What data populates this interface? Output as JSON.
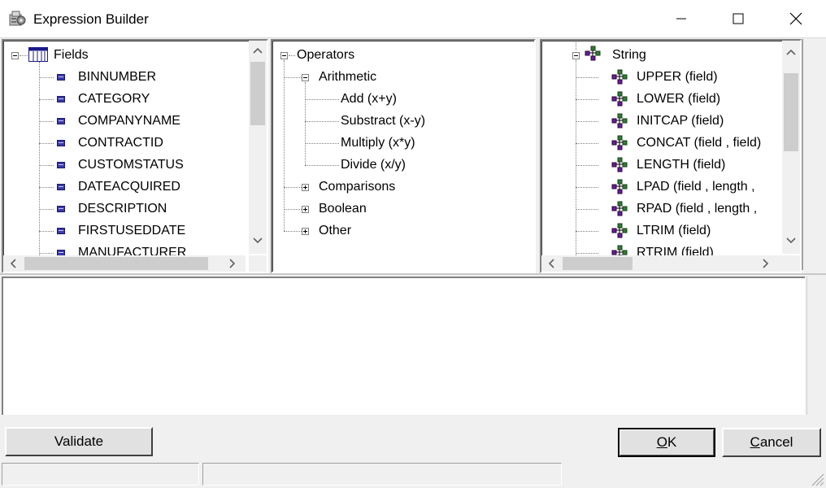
{
  "window": {
    "title": "Expression Builder",
    "icon": "app-icon",
    "controls": [
      "minimize-icon",
      "maximize-icon",
      "close-icon"
    ]
  },
  "fields_tree": {
    "root_label": "Fields",
    "items": [
      "BINNUMBER",
      "CATEGORY",
      "COMPANYNAME",
      "CONTRACTID",
      "CUSTOMSTATUS",
      "DATEACQUIRED",
      "DESCRIPTION",
      "FIRSTUSEDDATE",
      "MANUFACTURER"
    ]
  },
  "operators_tree": {
    "root_label": "Operators",
    "arithmetic": {
      "label": "Arithmetic",
      "items": [
        "Add (x+y)",
        "Substract (x-y)",
        "Multiply (x*y)",
        "Divide (x/y)"
      ]
    },
    "collapsed_groups": [
      "Comparisons",
      "Boolean",
      "Other"
    ]
  },
  "functions_tree": {
    "root_label": "String",
    "items": [
      "UPPER (field)",
      "LOWER (field)",
      "INITCAP (field)",
      "CONCAT (field , field)",
      "LENGTH (field)",
      "LPAD (field , length ,",
      "RPAD (field , length ,",
      "LTRIM (field)",
      "RTRIM (field)"
    ]
  },
  "expression": {
    "value": ""
  },
  "buttons": {
    "validate": "Validate",
    "ok_accel": "O",
    "ok_rest": "K",
    "cancel_accel": "C",
    "cancel_rest": "ancel"
  },
  "status": {
    "panel1": "",
    "panel2": ""
  }
}
